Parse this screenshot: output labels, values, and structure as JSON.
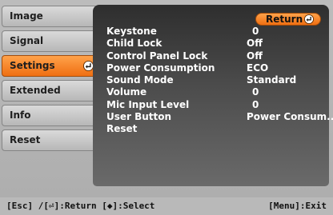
{
  "sidebar": {
    "items": [
      {
        "label": "Image"
      },
      {
        "label": "Signal"
      },
      {
        "label": "Settings"
      },
      {
        "label": "Extended"
      },
      {
        "label": "Info"
      },
      {
        "label": "Reset"
      }
    ],
    "active_index": 2
  },
  "return_button": {
    "label": "Return",
    "icon": "enter-return-icon"
  },
  "settings": [
    {
      "label": "Keystone",
      "value": "0"
    },
    {
      "label": "Child Lock",
      "value": "Off"
    },
    {
      "label": "Control Panel Lock",
      "value": "Off"
    },
    {
      "label": "Power Consumption",
      "value": "ECO"
    },
    {
      "label": "Sound Mode",
      "value": "Standard"
    },
    {
      "label": "Volume",
      "value": "0"
    },
    {
      "label": "Mic Input Level",
      "value": "0"
    },
    {
      "label": "User Button",
      "value": "Power Consum..."
    },
    {
      "label": "Reset",
      "value": ""
    }
  ],
  "footer": {
    "left": "[Esc] /[⏎]:Return [◆]:Select",
    "right": "[Menu]:Exit"
  },
  "colors": {
    "accent_orange": "#f07a1c",
    "panel_dark": "#2e2e2e",
    "background_gray": "#b4b4b4"
  }
}
